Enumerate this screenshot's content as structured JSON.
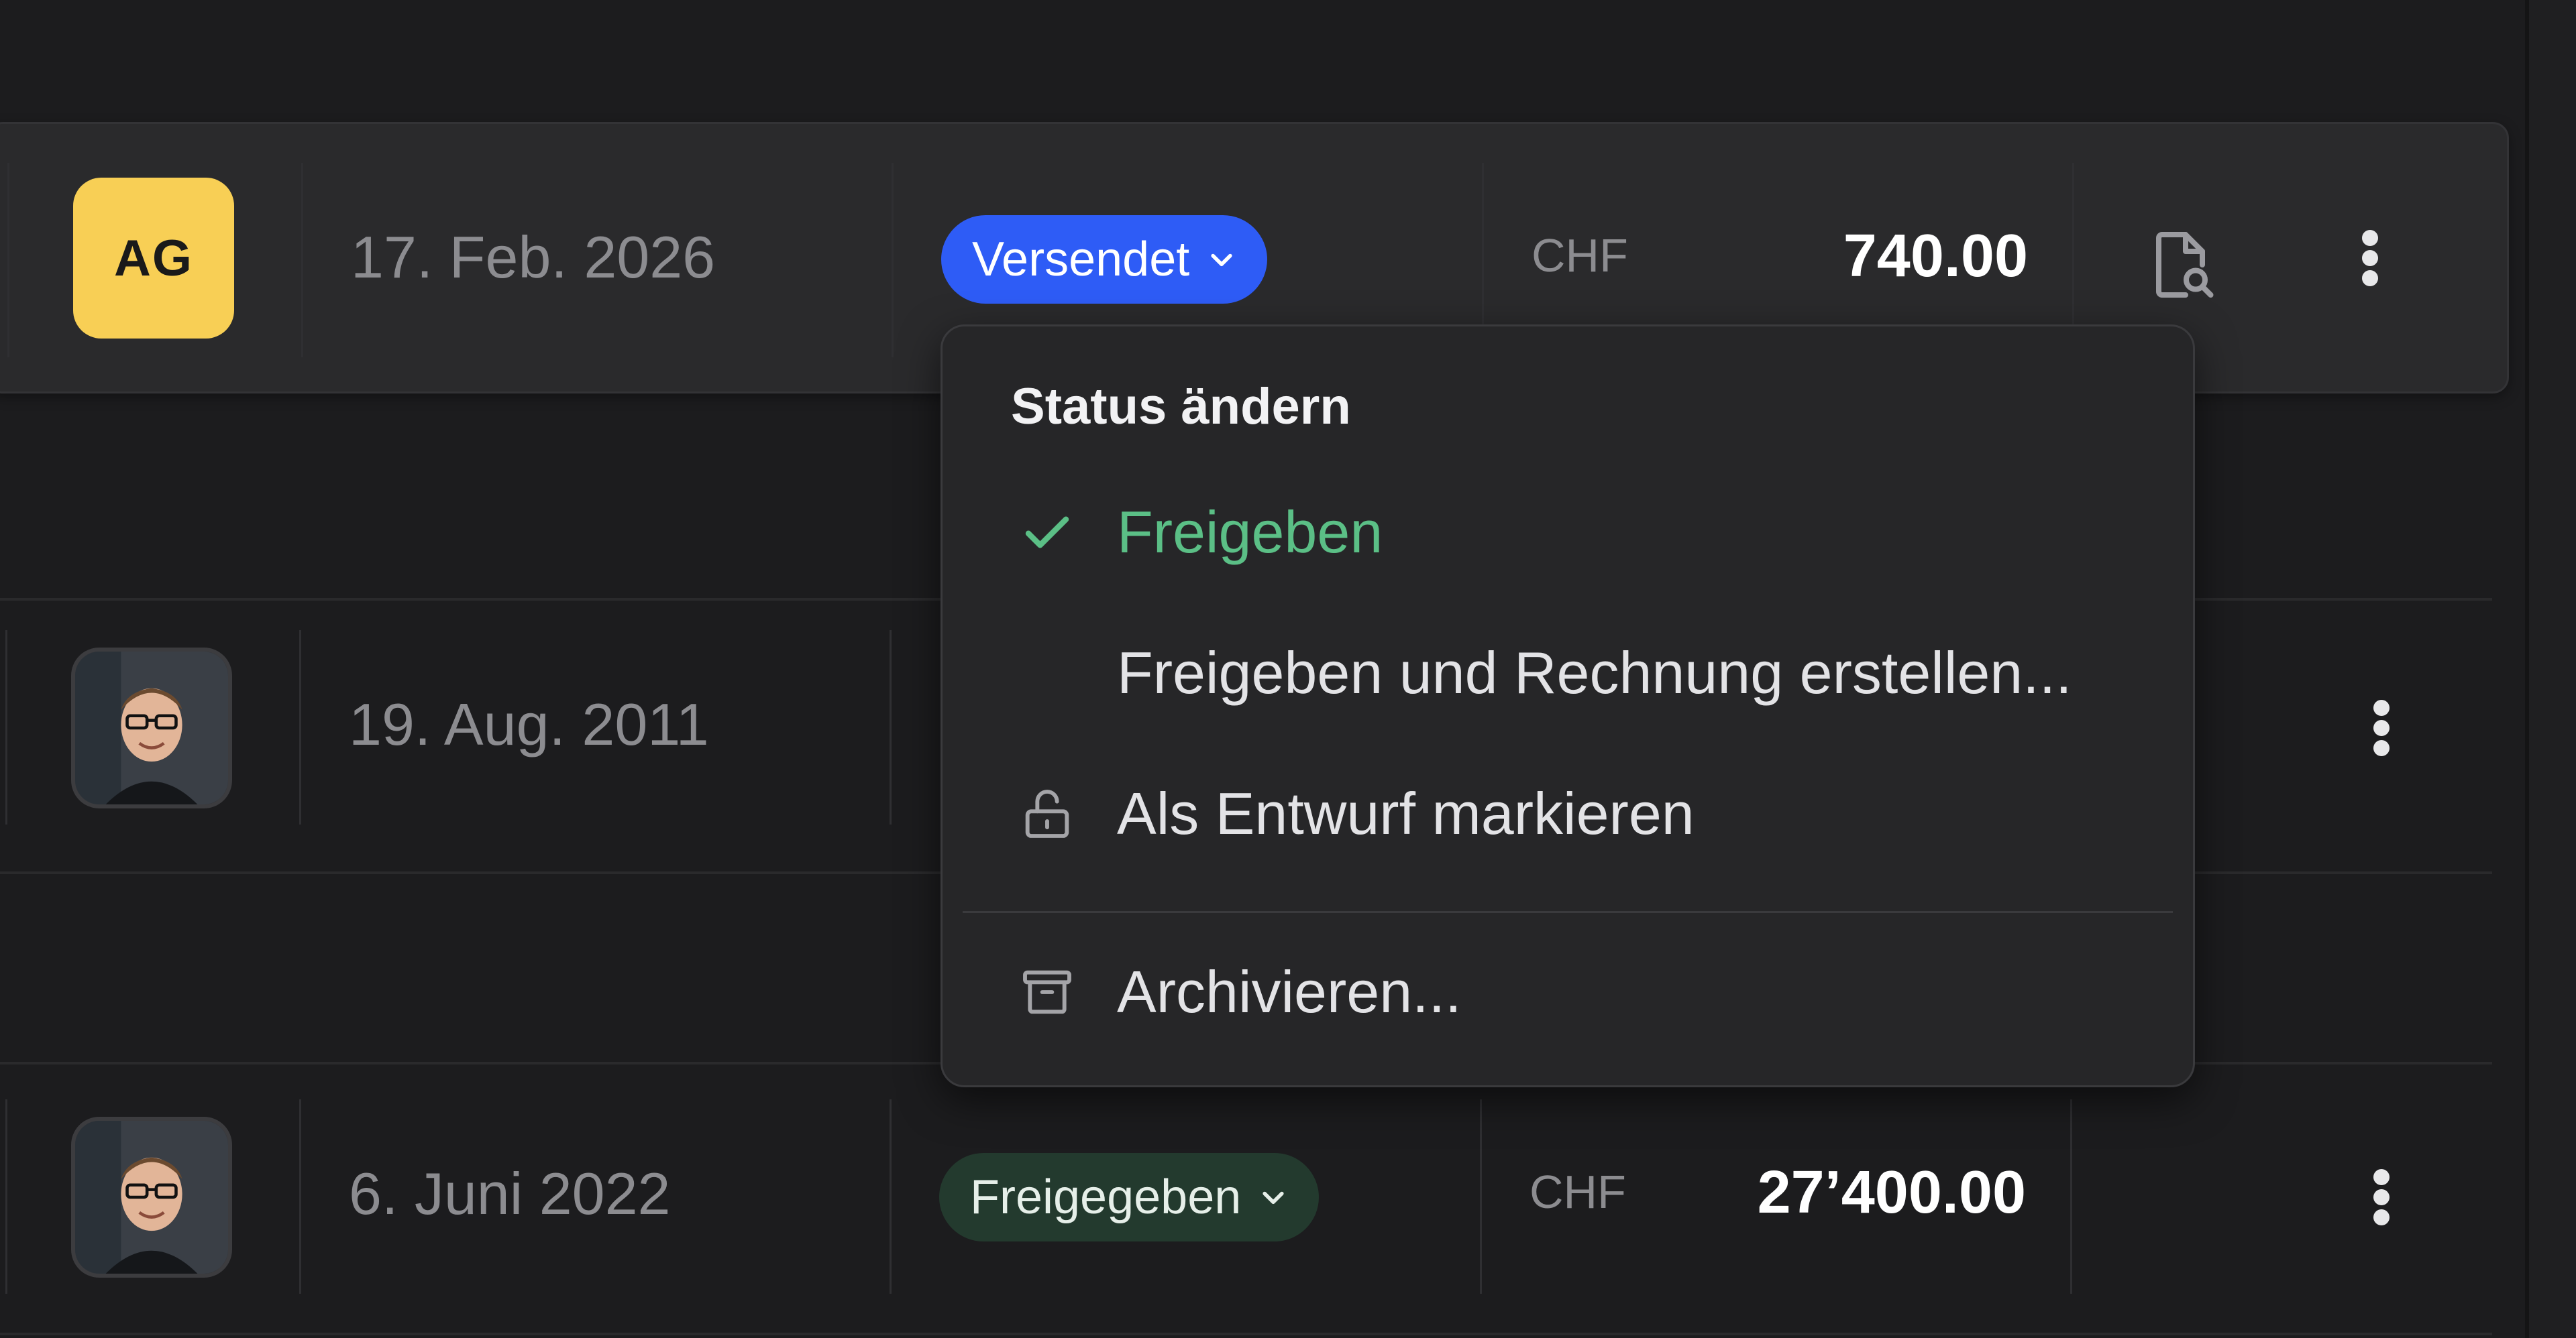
{
  "rows": [
    {
      "avatar": {
        "type": "initials",
        "text": "AG",
        "color": "#f8cf55"
      },
      "date": "17. Feb. 2026",
      "status": {
        "label": "Versendet",
        "color": "#2e5cf6"
      },
      "currency": "CHF",
      "amount": "740.00",
      "actions": [
        "document-search-icon",
        "more-vertical-icon"
      ]
    },
    {
      "avatar": {
        "type": "photo"
      },
      "date": "19. Aug. 2011",
      "actions": [
        "more-vertical-icon"
      ]
    },
    {
      "avatar": {
        "type": "photo"
      },
      "date": "6. Juni 2022",
      "status": {
        "label": "Freigegeben",
        "color": "#233a2e"
      },
      "currency": "CHF",
      "amount": "27’400.00",
      "actions": [
        "more-vertical-icon"
      ]
    }
  ],
  "status_menu": {
    "title": "Status ändern",
    "items": [
      {
        "label": "Freigeben",
        "icon": "check-icon",
        "checked": true,
        "color": "#5bbf86"
      },
      {
        "label": "Freigeben und Rechnung erstellen...",
        "icon": ""
      },
      {
        "label": "Als Entwurf markieren",
        "icon": "unlock-icon"
      },
      {
        "label": "Archivieren...",
        "icon": "archive-icon"
      }
    ]
  }
}
